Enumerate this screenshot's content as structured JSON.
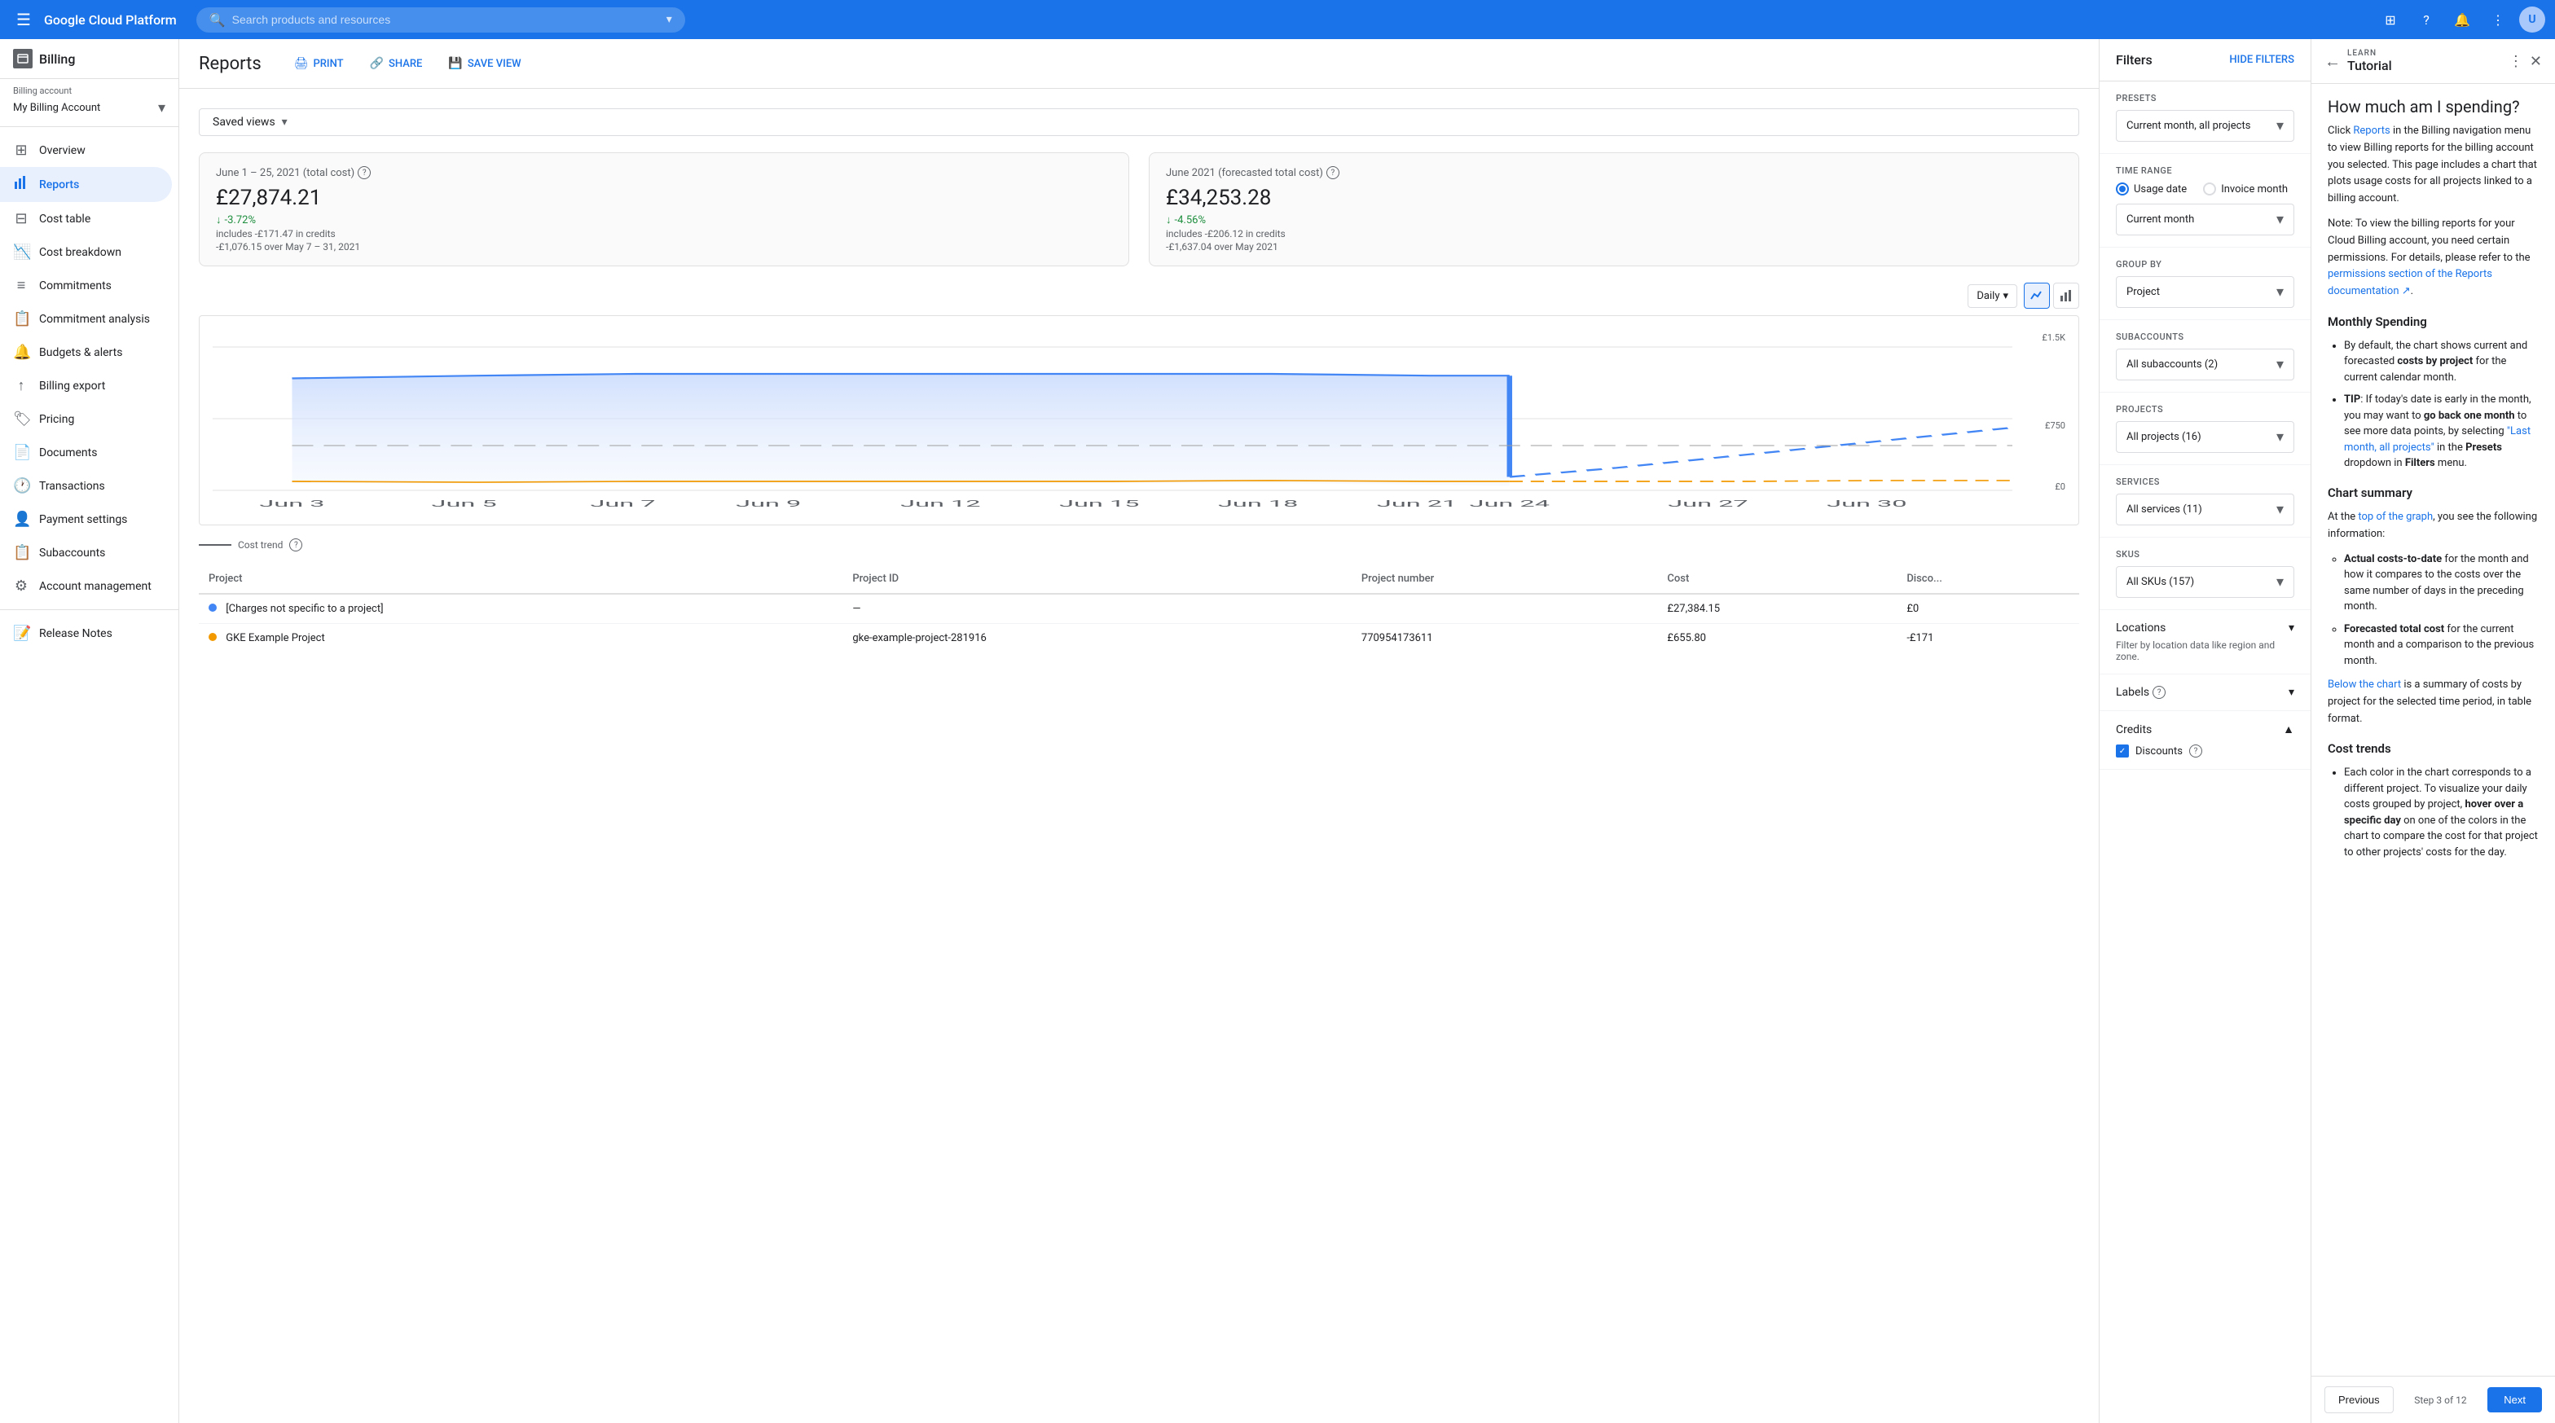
{
  "topbar": {
    "menu_label": "☰",
    "logo": "Google Cloud Platform",
    "search_placeholder": "Search products and resources",
    "dropdown_icon": "▾",
    "avatar_initials": "U"
  },
  "sidebar": {
    "billing_title": "Billing",
    "billing_account_label": "Billing account",
    "billing_account_name": "My Billing Account",
    "nav_items": [
      {
        "id": "overview",
        "label": "Overview",
        "icon": "⊞"
      },
      {
        "id": "reports",
        "label": "Reports",
        "icon": "📊",
        "active": true
      },
      {
        "id": "cost-table",
        "label": "Cost table",
        "icon": "⊟"
      },
      {
        "id": "cost-breakdown",
        "label": "Cost breakdown",
        "icon": "📉"
      },
      {
        "id": "commitments",
        "label": "Commitments",
        "icon": "≡"
      },
      {
        "id": "commitment-analysis",
        "label": "Commitment analysis",
        "icon": "📋"
      },
      {
        "id": "budgets-alerts",
        "label": "Budgets & alerts",
        "icon": "🔔"
      },
      {
        "id": "billing-export",
        "label": "Billing export",
        "icon": "↑"
      },
      {
        "id": "pricing",
        "label": "Pricing",
        "icon": "🏷"
      },
      {
        "id": "documents",
        "label": "Documents",
        "icon": "📄"
      },
      {
        "id": "transactions",
        "label": "Transactions",
        "icon": "🕐"
      },
      {
        "id": "payment-settings",
        "label": "Payment settings",
        "icon": "👤"
      },
      {
        "id": "subaccounts",
        "label": "Subaccounts",
        "icon": "📋"
      },
      {
        "id": "account-management",
        "label": "Account management",
        "icon": "⚙"
      },
      {
        "id": "release-notes",
        "label": "Release Notes",
        "icon": "📝"
      }
    ]
  },
  "reports": {
    "title": "Reports",
    "print_label": "PRINT",
    "share_label": "SHARE",
    "save_view_label": "SAVE VIEW",
    "saved_views_label": "Saved views",
    "cost_card_1": {
      "title": "June 1 – 25, 2021 (total cost)",
      "amount": "£27,874.21",
      "change": "-3.72%",
      "note1": "includes -£171.47 in credits",
      "note2": "-£1,076.15 over May 7 – 31, 2021"
    },
    "cost_card_2": {
      "title": "June 2021 (forecasted total cost)",
      "amount": "£34,253.28",
      "change": "-4.56%",
      "note1": "includes -£206.12 in credits",
      "note2": "-£1,637.04 over May 2021"
    },
    "chart_interval": "Daily",
    "chart_y_top": "£1.5K",
    "chart_y_mid": "£750",
    "chart_y_bottom": "£0",
    "chart_x_labels": [
      "Jun 3",
      "Jun 5",
      "Jun 7",
      "Jun 9",
      "Jun 12",
      "Jun 15",
      "Jun 18",
      "Jun 21",
      "Jun 24",
      "Jun 27",
      "Jun 30"
    ],
    "cost_trend_label": "Cost trend",
    "table_headers": [
      "Project",
      "Project ID",
      "Project number",
      "Cost",
      "Disco..."
    ],
    "table_rows": [
      {
        "dot": "blue",
        "project": "[Charges not specific to a project]",
        "project_id": "—",
        "project_number": "",
        "cost": "£27,384.15",
        "discount": "£0"
      },
      {
        "dot": "orange",
        "project": "GKE Example Project",
        "project_id": "gke-example-project-281916",
        "project_number": "770954173611",
        "cost": "£655.80",
        "discount": "-£171"
      }
    ]
  },
  "filters": {
    "title": "Filters",
    "hide_label": "HIDE FILTERS",
    "presets_label": "Presets",
    "presets_value": "Current month, all projects",
    "time_range_label": "Time range",
    "usage_date_label": "Usage date",
    "invoice_month_label": "Invoice month",
    "time_period_value": "Current month",
    "group_by_label": "Group by",
    "group_by_value": "Project",
    "subaccounts_label": "Subaccounts",
    "subaccounts_value": "All subaccounts (2)",
    "projects_label": "Projects",
    "projects_value": "All projects (16)",
    "services_label": "Services",
    "services_value": "All services (11)",
    "skus_label": "SKUs",
    "skus_value": "All SKUs (157)",
    "locations_label": "Locations",
    "locations_desc": "Filter by location data like region and zone.",
    "labels_label": "Labels",
    "credits_label": "Credits",
    "discounts_label": "Discounts"
  },
  "tutorial": {
    "learn_label": "LEARN",
    "subtitle": "Tutorial",
    "title": "How much am I spending?",
    "body_paragraphs": [
      "Click Reports in the Billing navigation menu to view Billing reports for the billing account you selected. This page includes a chart that plots usage costs for all projects linked to a billing account.",
      "Note: To view the billing reports for your Cloud Billing account, you need certain permissions. For details, please refer to the permissions section of the Reports documentation ↗."
    ],
    "section_monthly": "Monthly Spending",
    "monthly_bullets": [
      "By default, the chart shows current and forecasted costs by project for the current calendar month.",
      "TIP: If today's date is early in the month, you may want to go back one month to see more data points, by selecting \"Last month, all projects\" in the Presets dropdown in Filters menu."
    ],
    "section_chart": "Chart summary",
    "chart_bullets_intro": "At the top of the graph, you see the following information:",
    "chart_sub_bullets": [
      "Actual costs-to-date for the month and how it compares to the costs over the same number of days in the preceding month.",
      "Forecasted total cost for the current month and a comparison to the previous month."
    ],
    "chart_below": "Below the chart is a summary of costs by project for the selected time period, in table format.",
    "section_trends": "Cost trends",
    "trends_bullet": "Each color in the chart corresponds to a different project. To visualize your daily costs grouped by project, hover over a specific day on one of the colors in the chart to compare the cost for that project to other projects' costs for the day.",
    "prev_label": "Previous",
    "step_label": "Step 3 of 12",
    "next_label": "Next"
  }
}
